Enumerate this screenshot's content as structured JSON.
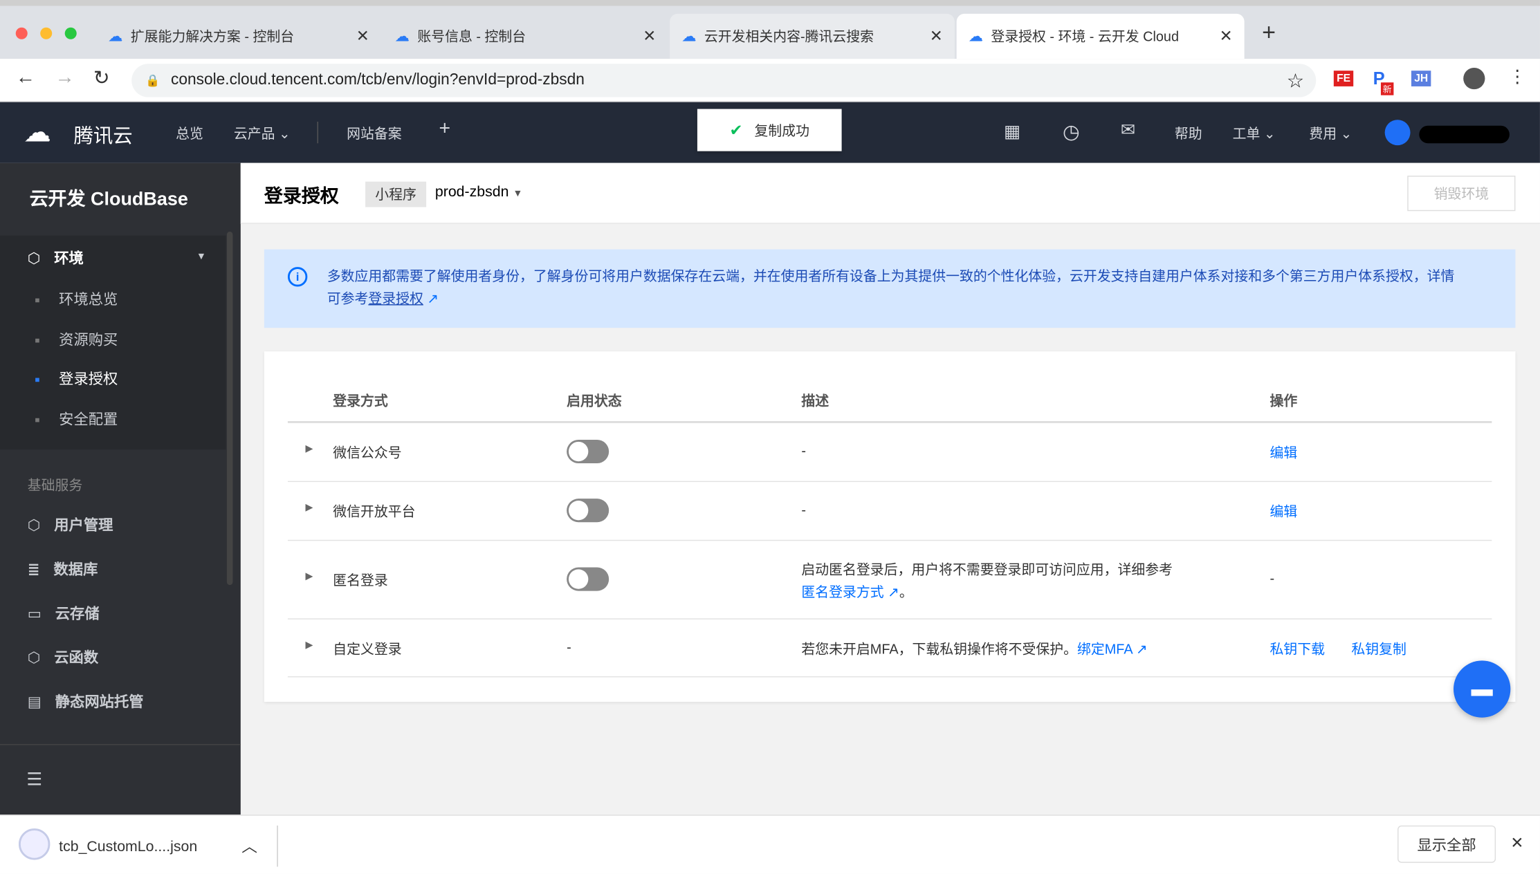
{
  "browser": {
    "tabs": [
      {
        "title": "扩展能力解决方案 - 控制台"
      },
      {
        "title": "账号信息 - 控制台"
      },
      {
        "title": "云开发相关内容-腾讯云搜索"
      },
      {
        "title": "登录授权 - 环境 - 云开发 Cloud"
      }
    ],
    "url": "console.cloud.tencent.com/tcb/env/login?envId=prod-zbsdn",
    "extensions": [
      "FE",
      "P",
      "JH"
    ],
    "ext_badge": "新"
  },
  "topnav": {
    "brand": "腾讯云",
    "items": [
      "总览",
      "云产品 ⌄",
      "网站备案"
    ],
    "right": [
      "帮助",
      "工单 ⌄",
      "费用 ⌄"
    ],
    "toast": "复制成功"
  },
  "sidebar": {
    "title": "云开发 CloudBase",
    "env_group": "环境",
    "env_items": [
      "环境总览",
      "资源购买",
      "登录授权",
      "安全配置"
    ],
    "section": "基础服务",
    "services": [
      "用户管理",
      "数据库",
      "云存储",
      "云函数",
      "静态网站托管"
    ]
  },
  "page": {
    "title": "登录授权",
    "env_type": "小程序",
    "env_id": "prod-zbsdn",
    "destroy_button": "销毁环境",
    "info_text": "多数应用都需要了解使用者身份，了解身份可将用户数据保存在云端，并在使用者所有设备上为其提供一致的个性化体验，云开发支持自建用户体系对接和多个第三方用户体系授权，详情可参考",
    "info_link": "登录授权"
  },
  "table": {
    "headers": [
      "登录方式",
      "启用状态",
      "描述",
      "操作"
    ],
    "rows": [
      {
        "name": "微信公众号",
        "enabled": false,
        "desc": "-",
        "actions": [
          "编辑"
        ]
      },
      {
        "name": "微信开放平台",
        "enabled": false,
        "desc": "-",
        "actions": [
          "编辑"
        ]
      },
      {
        "name": "匿名登录",
        "enabled": false,
        "desc": "启动匿名登录后，用户将不需要登录即可访问应用，详细参考",
        "desc_link": "匿名登录方式",
        "desc_end": "。",
        "actions": [
          "-"
        ]
      },
      {
        "name": "自定义登录",
        "status": "-",
        "desc": "若您未开启MFA，下载私钥操作将不受保护。",
        "desc_link": "绑定MFA",
        "actions": [
          "私钥下载",
          "私钥复制"
        ]
      }
    ]
  },
  "download": {
    "file": "tcb_CustomLo....json",
    "show_all": "显示全部"
  },
  "colors": {
    "accent": "#006eff",
    "nav": "#232a38",
    "sidebar": "#2e3035"
  }
}
